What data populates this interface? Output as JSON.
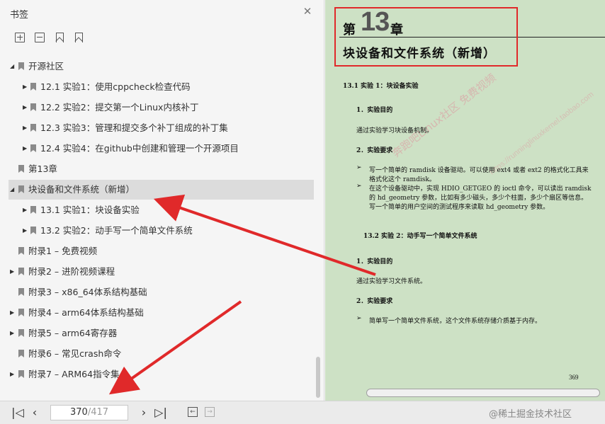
{
  "panel": {
    "title": "书签",
    "close_icon": "close-icon",
    "tools": [
      "expand-all-icon",
      "collapse-all-icon",
      "add-bookmark-icon",
      "bookmark-icon"
    ]
  },
  "bookmarks": [
    {
      "label": "开源社区",
      "arrow": "▲",
      "level": 0
    },
    {
      "label": "12.1  实验1：使用cppcheck检查代码",
      "arrow": "▶",
      "level": 1
    },
    {
      "label": "12.2  实验2：提交第一个Linux内核补丁",
      "arrow": "▶",
      "level": 1
    },
    {
      "label": "12.3  实验3：管理和提交多个补丁组成的补丁集",
      "arrow": "▶",
      "level": 1
    },
    {
      "label": "12.4  实验4：在github中创建和管理一个开源项目",
      "arrow": "▶",
      "level": 1
    },
    {
      "label": "第13章",
      "arrow": "",
      "level": 0
    },
    {
      "label": "块设备和文件系统（新增）",
      "arrow": "▲",
      "level": 0,
      "selected": true
    },
    {
      "label": "13.1  实验1：块设备实验",
      "arrow": "▶",
      "level": 1
    },
    {
      "label": "13.2  实验2：动手写一个简单文件系统",
      "arrow": "▶",
      "level": 1
    },
    {
      "label": "附录1 – 免费视频",
      "arrow": "",
      "level": 0
    },
    {
      "label": "附录2 – 进阶视频课程",
      "arrow": "▶",
      "level": 0
    },
    {
      "label": "附录3 – x86_64体系结构基础",
      "arrow": "",
      "level": 0
    },
    {
      "label": "附录4 – arm64体系结构基础",
      "arrow": "▶",
      "level": 0
    },
    {
      "label": "附录5 – arm64寄存器",
      "arrow": "▶",
      "level": 0
    },
    {
      "label": "附录6 – 常见crash命令",
      "arrow": "",
      "level": 0
    },
    {
      "label": "附录7 – ARM64指令集",
      "arrow": "▶",
      "level": 0
    }
  ],
  "document": {
    "chapter_prefix": "第",
    "chapter_number": "13",
    "chapter_suffix": "章",
    "chapter_title": "块设备和文件系统（新增）",
    "s131_heading": "13.1    实验 1：块设备实验",
    "h1_purpose": "1．实验目的",
    "p1_purpose": "通过实验学习块设备机制。",
    "h1_req": "2．实验要求",
    "b1_line1": "写一个简单的 ramdisk 设备驱动。可以使用 ext4 或者 ext2 的格式化工具来",
    "b1_line2": "格式化这个 ramdisk。",
    "b2_line1": "在这个设备驱动中，实现 HDIO_GETGEO 的 ioctl 命令，可以读出 ramdisk",
    "b2_line2": "的 hd_geometry 参数，比如有多少磁头，多少个柱面，多少个扇区等信息。",
    "b2_line3": "写一个简单的用户空间的测试程序来读取 hd_geometry 参数。",
    "s132_heading": "13.2    实验 2：动手写一个简单文件系统",
    "h2_purpose": "1．实验目的",
    "p2_purpose": "通过实验学习文件系统。",
    "h2_req": "2．实验要求",
    "b3_line1": "简单写一个简单文件系统，这个文件系统存储介质基于内存。",
    "page_number": "369",
    "bullet_char": "➢",
    "watermark": "奔跑吧Linux社区 免费视频",
    "watermark_url": "https://runninglinuxkernel.taobao.com"
  },
  "navbar": {
    "current_page": "370",
    "total_pages": "/417",
    "credit_text": "@稀土掘金技术社区"
  },
  "colors": {
    "annotation_red": "#e0292a",
    "page_background": "#cde1c5",
    "selection": "#dcdcdc"
  }
}
